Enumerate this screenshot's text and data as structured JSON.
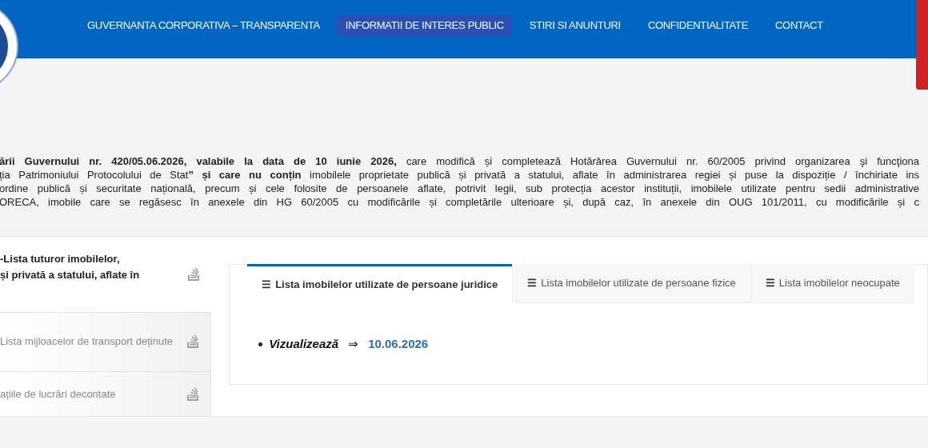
{
  "nav": {
    "items": [
      {
        "label": "GUVERNANTA CORPORATIVA – TRANSPARENTA",
        "selected": false
      },
      {
        "label": "INFORMATII DE INTERES PUBLIC",
        "selected": true
      },
      {
        "label": "STIRI SI ANUNTURI",
        "selected": false
      },
      {
        "label": "CONFIDENTIALITATE",
        "selected": false
      },
      {
        "label": "CONTACT",
        "selected": false
      }
    ]
  },
  "intro": {
    "lines": [
      "**ării Guvernului nr. 420/05.06.2026, valabile la data de 10 iunie 2026,** care modifică și completează Hotărârea Guvernului nr. 60/2005 privind organizarea şi funcţiona",
      "ția Patrimoniului Protocolului de Stat**” și care nu conțin** imobilele proprietate publică și privată a statului, aflate în administrarea regiei și puse la dispoziție / închiriate ins",
      "ordine publică și securitate națională, precum și cele folosite de persoanele aflate, potrivit legii, sub protecția acestor instituții, imobilele utilizate pentru sedii administrative",
      "ORECA, imobile care se regăsesc în anexele din HG 60/2005 cu modificările și completările ulterioare și, după caz, în anexele din OUG 101/2011, cu modificările și c"
    ]
  },
  "sidebar": {
    "items": [
      {
        "lines": [
          "-Lista tuturor imobilelor,",
          "și privată a statului, aflate în"
        ],
        "selected": true
      },
      {
        "lines": [
          "Lista mijloacelor de transport deținute"
        ],
        "selected": false
      },
      {
        "lines": [
          "ațiile de lucrări decontate"
        ],
        "selected": false
      }
    ]
  },
  "tabs": [
    {
      "icon": "☰",
      "label": "Lista imobilelor utilizate de persoane juridice",
      "selected": true
    },
    {
      "icon": "☰",
      "label": "Lista imobilelor utilizate de persoane fizice",
      "selected": false
    },
    {
      "icon": "☰",
      "label": "Lista imobilelor neocupate",
      "selected": false
    }
  ],
  "content": {
    "items": [
      {
        "label": "Vizualizează",
        "arrow": "⇒",
        "link": "10.06.2026"
      }
    ]
  }
}
